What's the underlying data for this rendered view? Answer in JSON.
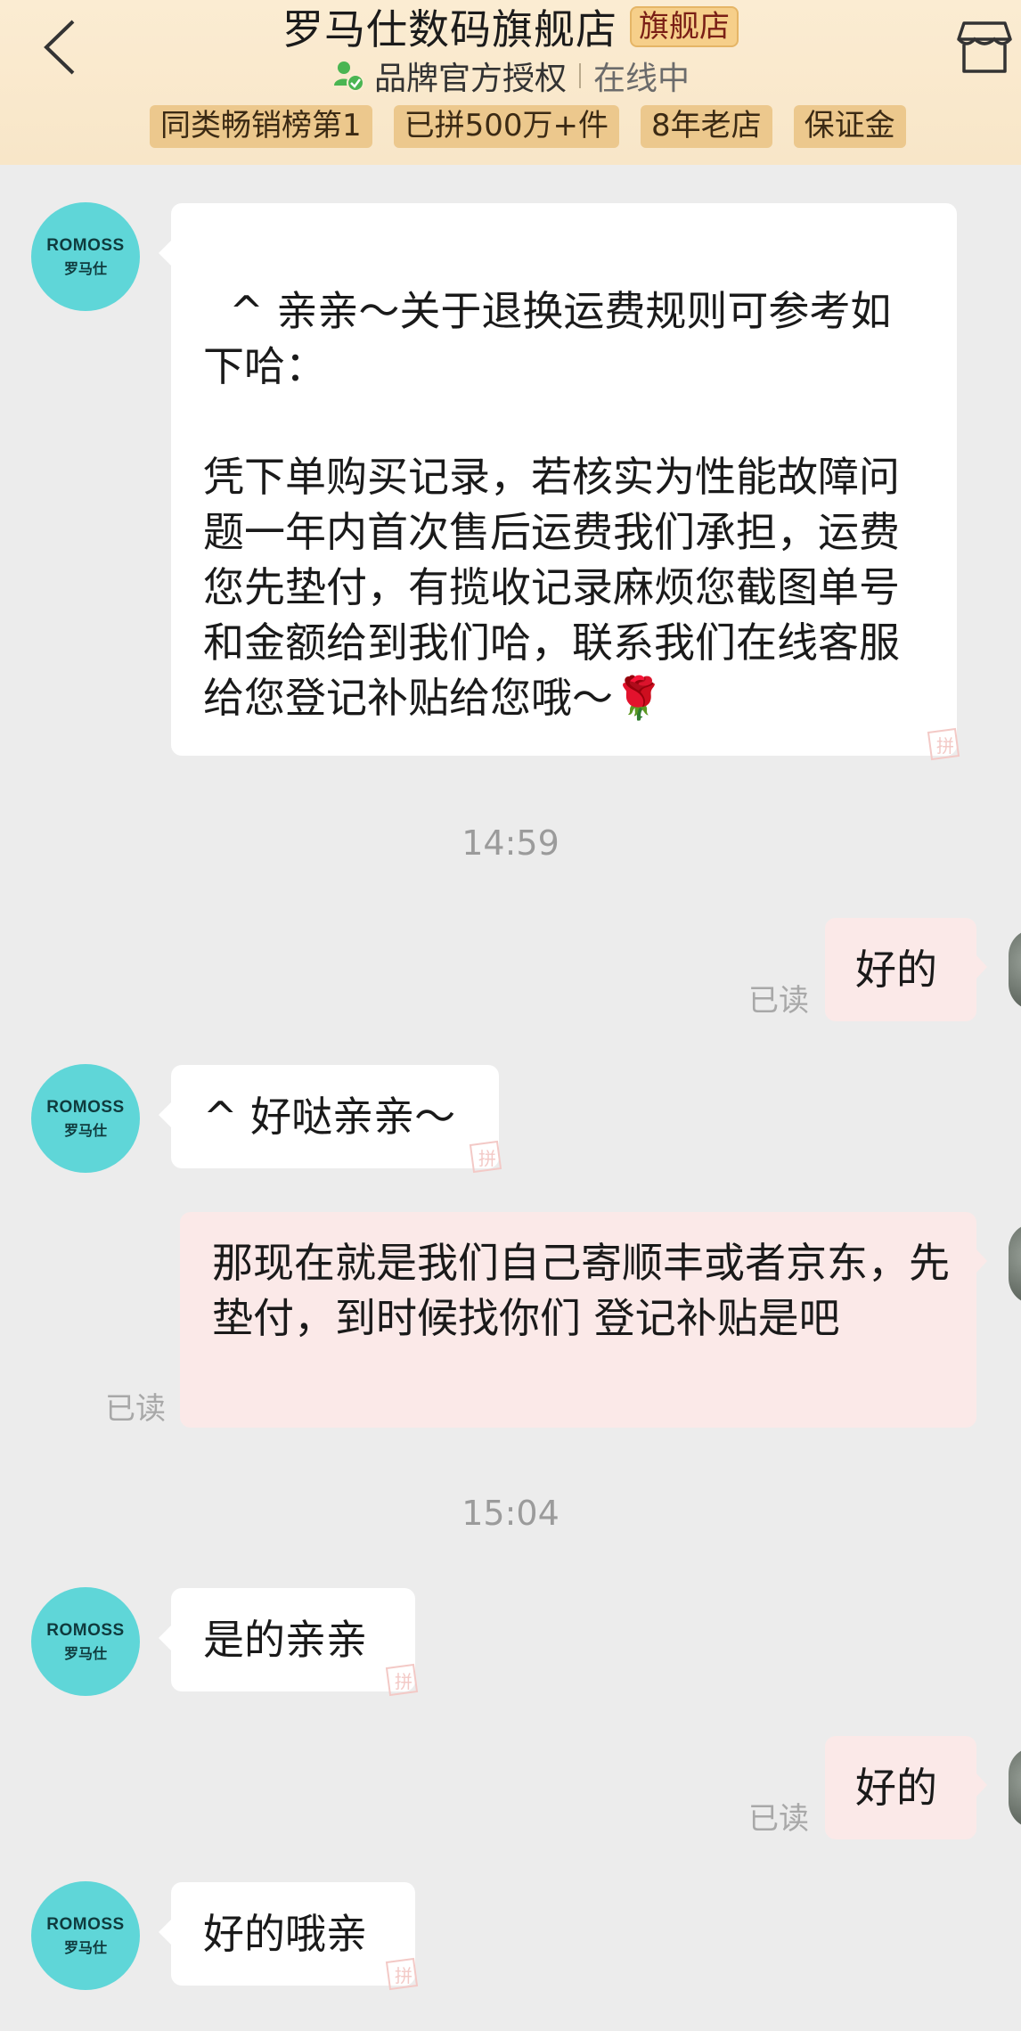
{
  "header": {
    "store_name": "罗马仕数码旗舰店",
    "store_badge": "旗舰店",
    "authorization": "品牌官方授权",
    "status": "在线中",
    "tags": [
      "同类畅销榜第1",
      "已拼500万+件",
      "8年老店",
      "保证金"
    ],
    "icons": {
      "back": "chevron-left-icon",
      "store": "storefront-icon",
      "verified": "brand-verified-icon"
    }
  },
  "avatar": {
    "brand_en": "ROMOSS",
    "brand_cn": "罗马仕"
  },
  "messages": {
    "m1": {
      "text": "^ 亲亲～关于退换运费规则可参考如下哈：\n\n凭下单购买记录，若核实为性能故障问题一年内首次售后运费我们承担，运费您先垫付，有揽收记录麻烦您截图单号和金额给到我们哈，联系我们在线客服给您登记补贴给您哦～🌹\n"
    },
    "t1": {
      "time": "14:59"
    },
    "m2": {
      "text": "好的",
      "read": "已读"
    },
    "m3": {
      "text": "^ 好哒亲亲～"
    },
    "m4": {
      "text": "那现在就是我们自己寄顺丰或者京东，先垫付，到时候找你们 登记补贴是吧",
      "read": "已读"
    },
    "t2": {
      "time": "15:04"
    },
    "m5": {
      "text": "是的亲亲"
    },
    "m6": {
      "text": "好的",
      "read": "已读"
    },
    "m7": {
      "text": "好的哦亲"
    }
  },
  "colors": {
    "header_bg": "#fbecd2",
    "tag_bg": "#ecc88d",
    "avatar": "#5fd6d8",
    "outgoing_bubble": "#fbe9e8",
    "incoming_bubble": "#ffffff",
    "chat_bg": "#ececec"
  }
}
